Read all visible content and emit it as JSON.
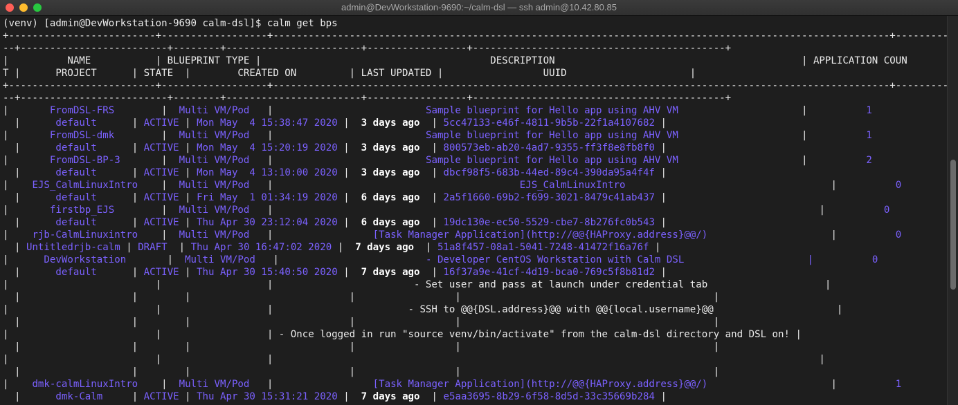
{
  "window": {
    "title": "admin@DevWorkstation-9690:~/calm-dsl — ssh admin@10.42.80.85"
  },
  "terminal": {
    "lines": [
      [
        [
          "d",
          "(venv) [admin@DevWorkstation-9690 calm-dsl]$ calm get bps"
        ]
      ],
      [
        [
          "d",
          "+-------------------------+------------------+---------------------------------------------------------------------------------------------------------+--------------------"
        ]
      ],
      [
        [
          "d",
          "--+-------------------------+--------+-----------------------+-----------------+-------------------------------------------+"
        ]
      ],
      [
        [
          "d",
          "|          NAME           | BLUEPRINT TYPE |                                       DESCRIPTION                                          | APPLICATION COUN"
        ]
      ],
      [
        [
          "d",
          "T |      PROJECT      | STATE  |        CREATED ON         | LAST UPDATED |                 UUID                     |"
        ]
      ],
      [
        [
          "d",
          "+-------------------------+------------------+---------------------------------------------------------------------------------------------------------+--------------------"
        ]
      ],
      [
        [
          "d",
          "--+-------------------------+--------+-----------------------+-----------------+-------------------------------------------+"
        ]
      ],
      [
        [
          "d",
          "|       "
        ],
        [
          "p",
          "FromDSL-FRS"
        ],
        [
          "d",
          "        |  "
        ],
        [
          "p",
          "Multi VM/Pod"
        ],
        [
          "d",
          "   |                          "
        ],
        [
          "p",
          "Sample blueprint for Hello app using AHV VM"
        ],
        [
          "d",
          "                     |          "
        ],
        [
          "p",
          "1"
        ]
      ],
      [
        [
          "d",
          "  |      "
        ],
        [
          "p",
          "default"
        ],
        [
          "d",
          "      | "
        ],
        [
          "p",
          "ACTIVE"
        ],
        [
          "d",
          " | "
        ],
        [
          "p",
          "Mon May  4 15:38:47 2020"
        ],
        [
          "d",
          " |  "
        ],
        [
          "b",
          "3 days ago"
        ],
        [
          "d",
          "  | "
        ],
        [
          "p",
          "5cc47133-e46f-4811-9b5b-22f1a4107682"
        ],
        [
          "d",
          " |"
        ]
      ],
      [
        [
          "d",
          "|       "
        ],
        [
          "p",
          "FromDSL-dmk"
        ],
        [
          "d",
          "        |  "
        ],
        [
          "p",
          "Multi VM/Pod"
        ],
        [
          "d",
          "   |                          "
        ],
        [
          "p",
          "Sample blueprint for Hello app using AHV VM"
        ],
        [
          "d",
          "                     |          "
        ],
        [
          "p",
          "1"
        ]
      ],
      [
        [
          "d",
          "  |      "
        ],
        [
          "p",
          "default"
        ],
        [
          "d",
          "      | "
        ],
        [
          "p",
          "ACTIVE"
        ],
        [
          "d",
          " | "
        ],
        [
          "p",
          "Mon May  4 15:20:19 2020"
        ],
        [
          "d",
          " |  "
        ],
        [
          "b",
          "3 days ago"
        ],
        [
          "d",
          "  | "
        ],
        [
          "p",
          "800573eb-ab20-4ad7-9355-ff3f8e8fb8f0"
        ],
        [
          "d",
          " |"
        ]
      ],
      [
        [
          "d",
          "|       "
        ],
        [
          "p",
          "FromDSL-BP-3"
        ],
        [
          "d",
          "       |  "
        ],
        [
          "p",
          "Multi VM/Pod"
        ],
        [
          "d",
          "   |                          "
        ],
        [
          "p",
          "Sample blueprint for Hello app using AHV VM"
        ],
        [
          "d",
          "                     |          "
        ],
        [
          "p",
          "2"
        ]
      ],
      [
        [
          "d",
          "  |      "
        ],
        [
          "p",
          "default"
        ],
        [
          "d",
          "      | "
        ],
        [
          "p",
          "ACTIVE"
        ],
        [
          "d",
          " | "
        ],
        [
          "p",
          "Mon May  4 13:10:00 2020"
        ],
        [
          "d",
          " |  "
        ],
        [
          "b",
          "3 days ago"
        ],
        [
          "d",
          "  | "
        ],
        [
          "p",
          "dbcf98f5-683b-44ed-89c4-390da95a4f4f"
        ],
        [
          "d",
          " |"
        ]
      ],
      [
        [
          "d",
          "|    "
        ],
        [
          "p",
          "EJS_CalmLinuxIntro"
        ],
        [
          "d",
          "    |  "
        ],
        [
          "p",
          "Multi VM/Pod"
        ],
        [
          "d",
          "   |                                          "
        ],
        [
          "p",
          "EJS_CalmLinuxIntro"
        ],
        [
          "d",
          "                                   |          "
        ],
        [
          "p",
          "0"
        ]
      ],
      [
        [
          "d",
          "  |      "
        ],
        [
          "p",
          "default"
        ],
        [
          "d",
          "      | "
        ],
        [
          "p",
          "ACTIVE"
        ],
        [
          "d",
          " | "
        ],
        [
          "p",
          "Fri May  1 01:34:19 2020"
        ],
        [
          "d",
          " |  "
        ],
        [
          "b",
          "6 days ago"
        ],
        [
          "d",
          "  | "
        ],
        [
          "p",
          "2a5f1660-69b2-f699-3021-8479c41ab437"
        ],
        [
          "d",
          " |"
        ]
      ],
      [
        [
          "d",
          "|       "
        ],
        [
          "p",
          "firstbp_EJS"
        ],
        [
          "d",
          "        |  "
        ],
        [
          "p",
          "Multi VM/Pod"
        ],
        [
          "d",
          "   |                                                                                             |          "
        ],
        [
          "p",
          "0"
        ]
      ],
      [
        [
          "d",
          "  |      "
        ],
        [
          "p",
          "default"
        ],
        [
          "d",
          "      | "
        ],
        [
          "p",
          "ACTIVE"
        ],
        [
          "d",
          " | "
        ],
        [
          "p",
          "Thu Apr 30 23:12:04 2020"
        ],
        [
          "d",
          " |  "
        ],
        [
          "b",
          "6 days ago"
        ],
        [
          "d",
          "  | "
        ],
        [
          "p",
          "19dc130e-ec50-5529-cbe7-8b276fc0b543"
        ],
        [
          "d",
          " |"
        ]
      ],
      [
        [
          "d",
          "|    "
        ],
        [
          "p",
          "rjb-CalmLinuxintro"
        ],
        [
          "d",
          "    |  "
        ],
        [
          "p",
          "Multi VM/Pod"
        ],
        [
          "d",
          "   |                 "
        ],
        [
          "p",
          "[Task Manager Application](http://@@{HAProxy.address}@@/)"
        ],
        [
          "d",
          "                     |          "
        ],
        [
          "p",
          "0"
        ]
      ],
      [
        [
          "d",
          "  | "
        ],
        [
          "p",
          "Untitledrjb-calm"
        ],
        [
          "d",
          " | "
        ],
        [
          "p",
          "DRAFT"
        ],
        [
          "d",
          "  | "
        ],
        [
          "p",
          "Thu Apr 30 16:47:02 2020"
        ],
        [
          "d",
          " |  "
        ],
        [
          "b",
          "7 days ago"
        ],
        [
          "d",
          "  | "
        ],
        [
          "p",
          "51a8f457-08a1-5041-7248-41472f16a76f"
        ],
        [
          "d",
          " |"
        ]
      ],
      [
        [
          "d",
          "|      "
        ],
        [
          "p",
          "DevWorkstation"
        ],
        [
          "d",
          "       |  "
        ],
        [
          "p",
          "Multi VM/Pod"
        ],
        [
          "d",
          "   |                         "
        ],
        [
          "p",
          "- Developer CentOS Workstation with Calm DSL"
        ],
        [
          "d",
          "                     "
        ],
        [
          "p",
          "|          0"
        ]
      ],
      [
        [
          "d",
          "  |      "
        ],
        [
          "p",
          "default"
        ],
        [
          "d",
          "      | "
        ],
        [
          "p",
          "ACTIVE"
        ],
        [
          "d",
          " | "
        ],
        [
          "p",
          "Thu Apr 30 15:40:50 2020"
        ],
        [
          "d",
          " |  "
        ],
        [
          "b",
          "7 days ago"
        ],
        [
          "d",
          "  | "
        ],
        [
          "p",
          "16f37a9e-41cf-4d19-bca0-769c5f8b81d2"
        ],
        [
          "d",
          " |"
        ]
      ],
      [
        [
          "d",
          "|                         |                  |                        - Set user and pass at launch under credential tab                    |"
        ]
      ],
      [
        [
          "d",
          "  |                   |        |                           |                 |                                           |"
        ]
      ],
      [
        [
          "d",
          "|                         |                  |                       - SSH to @@{DSL.address}@@ with @@{local.username}@@                     |"
        ]
      ],
      [
        [
          "d",
          "  |                   |        |                           |                 |                                           |"
        ]
      ],
      [
        [
          "d",
          "|                         |                  | - Once logged in run \"source venv/bin/activate\" from the calm-dsl directory and DSL on! |"
        ]
      ],
      [
        [
          "d",
          "  |                   |        |                           |                 |                                           |"
        ]
      ],
      [
        [
          "d",
          "|                         |                  |                                                                                             |"
        ]
      ],
      [
        [
          "d",
          "  |                   |        |                           |                 |                                           |"
        ]
      ],
      [
        [
          "d",
          "|    "
        ],
        [
          "p",
          "dmk-calmLinuxIntro"
        ],
        [
          "d",
          "    |  "
        ],
        [
          "p",
          "Multi VM/Pod"
        ],
        [
          "d",
          "   |                 "
        ],
        [
          "p",
          "[Task Manager Application](http://@@{HAProxy.address}@@/)"
        ],
        [
          "d",
          "                     |          "
        ],
        [
          "p",
          "1"
        ]
      ],
      [
        [
          "d",
          "  |      "
        ],
        [
          "p",
          "dmk-Calm"
        ],
        [
          "d",
          "     | "
        ],
        [
          "p",
          "ACTIVE"
        ],
        [
          "d",
          " | "
        ],
        [
          "p",
          "Thu Apr 30 15:31:21 2020"
        ],
        [
          "d",
          " |  "
        ],
        [
          "b",
          "7 days ago"
        ],
        [
          "d",
          "  | "
        ],
        [
          "p",
          "e5aa3695-8b29-6f58-8d5d-33c35669b284"
        ],
        [
          "d",
          " |"
        ]
      ]
    ]
  }
}
